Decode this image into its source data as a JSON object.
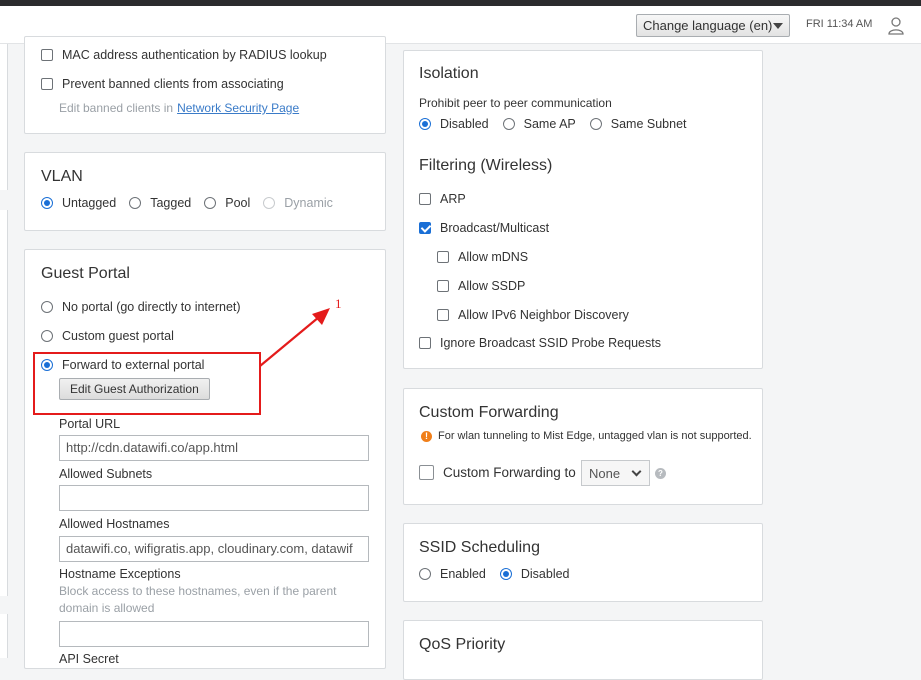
{
  "header": {
    "language_label": "Change language (en)",
    "clock": "FRI 11:34 AM"
  },
  "auth": {
    "mac_radius": "MAC address authentication by RADIUS lookup",
    "prevent_banned": "Prevent banned clients from associating",
    "edit_banned_prefix": "Edit banned clients in",
    "edit_banned_link": "Network Security Page"
  },
  "vlan": {
    "title": "VLAN",
    "options": [
      "Untagged",
      "Tagged",
      "Pool",
      "Dynamic"
    ],
    "selected": "Untagged"
  },
  "guest_portal": {
    "title": "Guest Portal",
    "options": [
      "No portal (go directly to internet)",
      "Custom guest portal",
      "Forward to external portal"
    ],
    "selected": "Forward to external portal",
    "edit_button": "Edit Guest Authorization",
    "portal_url_label": "Portal URL",
    "portal_url_value": "http://cdn.datawifi.co/app.html",
    "allowed_subnets_label": "Allowed Subnets",
    "allowed_subnets_value": "",
    "allowed_hostnames_label": "Allowed Hostnames",
    "allowed_hostnames_value": "datawifi.co, wifigratis.app, cloudinary.com, datawif",
    "hostname_exceptions_label": "Hostname Exceptions",
    "hostname_exceptions_help_1": "Block access to these hostnames, even if the parent",
    "hostname_exceptions_help_2": "domain is allowed",
    "hostname_exceptions_value": "",
    "api_secret_label": "API Secret"
  },
  "isolation": {
    "title": "Isolation",
    "subtitle": "Prohibit peer to peer communication",
    "options": [
      "Disabled",
      "Same AP",
      "Same Subnet"
    ],
    "selected": "Disabled"
  },
  "filtering": {
    "title": "Filtering (Wireless)",
    "arp": "ARP",
    "broadcast": "Broadcast/Multicast",
    "mdns": "Allow mDNS",
    "ssdp": "Allow SSDP",
    "ipv6": "Allow IPv6 Neighbor Discovery",
    "ignore_probe": "Ignore Broadcast SSID Probe Requests"
  },
  "custom_forwarding": {
    "title": "Custom Forwarding",
    "warning": "For wlan tunneling to Mist Edge, untagged vlan is not supported.",
    "checkbox_label": "Custom Forwarding to",
    "select_value": "None"
  },
  "ssid_scheduling": {
    "title": "SSID Scheduling",
    "options": [
      "Enabled",
      "Disabled"
    ],
    "selected": "Disabled"
  },
  "qos": {
    "title": "QoS Priority"
  },
  "annotation": {
    "number": "1",
    "color": "#e41b1b"
  },
  "colors": {
    "accent": "#1a6fd6",
    "link": "#3a7bc8",
    "warning": "#f07f1a"
  }
}
